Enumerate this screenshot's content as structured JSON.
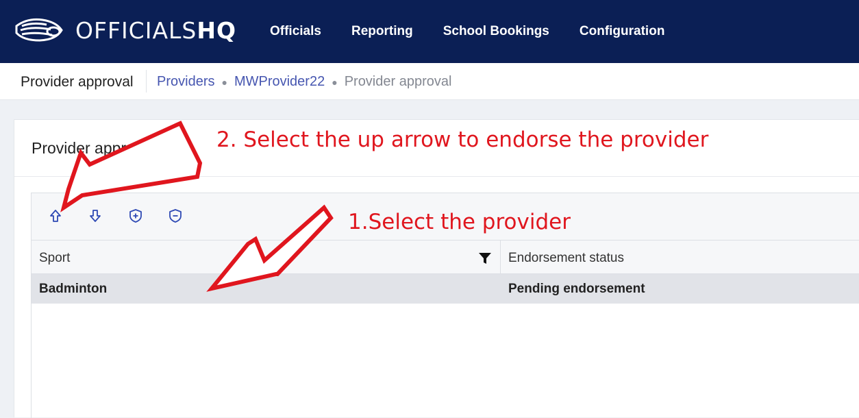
{
  "app": {
    "logo_light": "OFFICIALS",
    "logo_bold": "HQ"
  },
  "nav": {
    "items": [
      "Officials",
      "Reporting",
      "School Bookings",
      "Configuration"
    ]
  },
  "breadcrumb_bar": {
    "page_title": "Provider approval",
    "crumbs": [
      "Providers",
      "MWProvider22",
      "Provider approval"
    ]
  },
  "card": {
    "title": "Provider approval"
  },
  "toolbar": {
    "icons": [
      "up-arrow-icon",
      "down-arrow-icon",
      "shield-plus-icon",
      "shield-minus-icon"
    ]
  },
  "table": {
    "columns": [
      "Sport",
      "Endorsement status"
    ],
    "rows": [
      {
        "sport": "Badminton",
        "status": "Pending endorsement"
      }
    ]
  },
  "annotations": {
    "note2": "2. Select the up arrow to endorse the provider",
    "note1": "1.Select the provider"
  },
  "colors": {
    "nav_bg": "#0b1f55",
    "link": "#4656b0",
    "annotation": "#e0161e",
    "selected_row": "#e1e3e8"
  }
}
